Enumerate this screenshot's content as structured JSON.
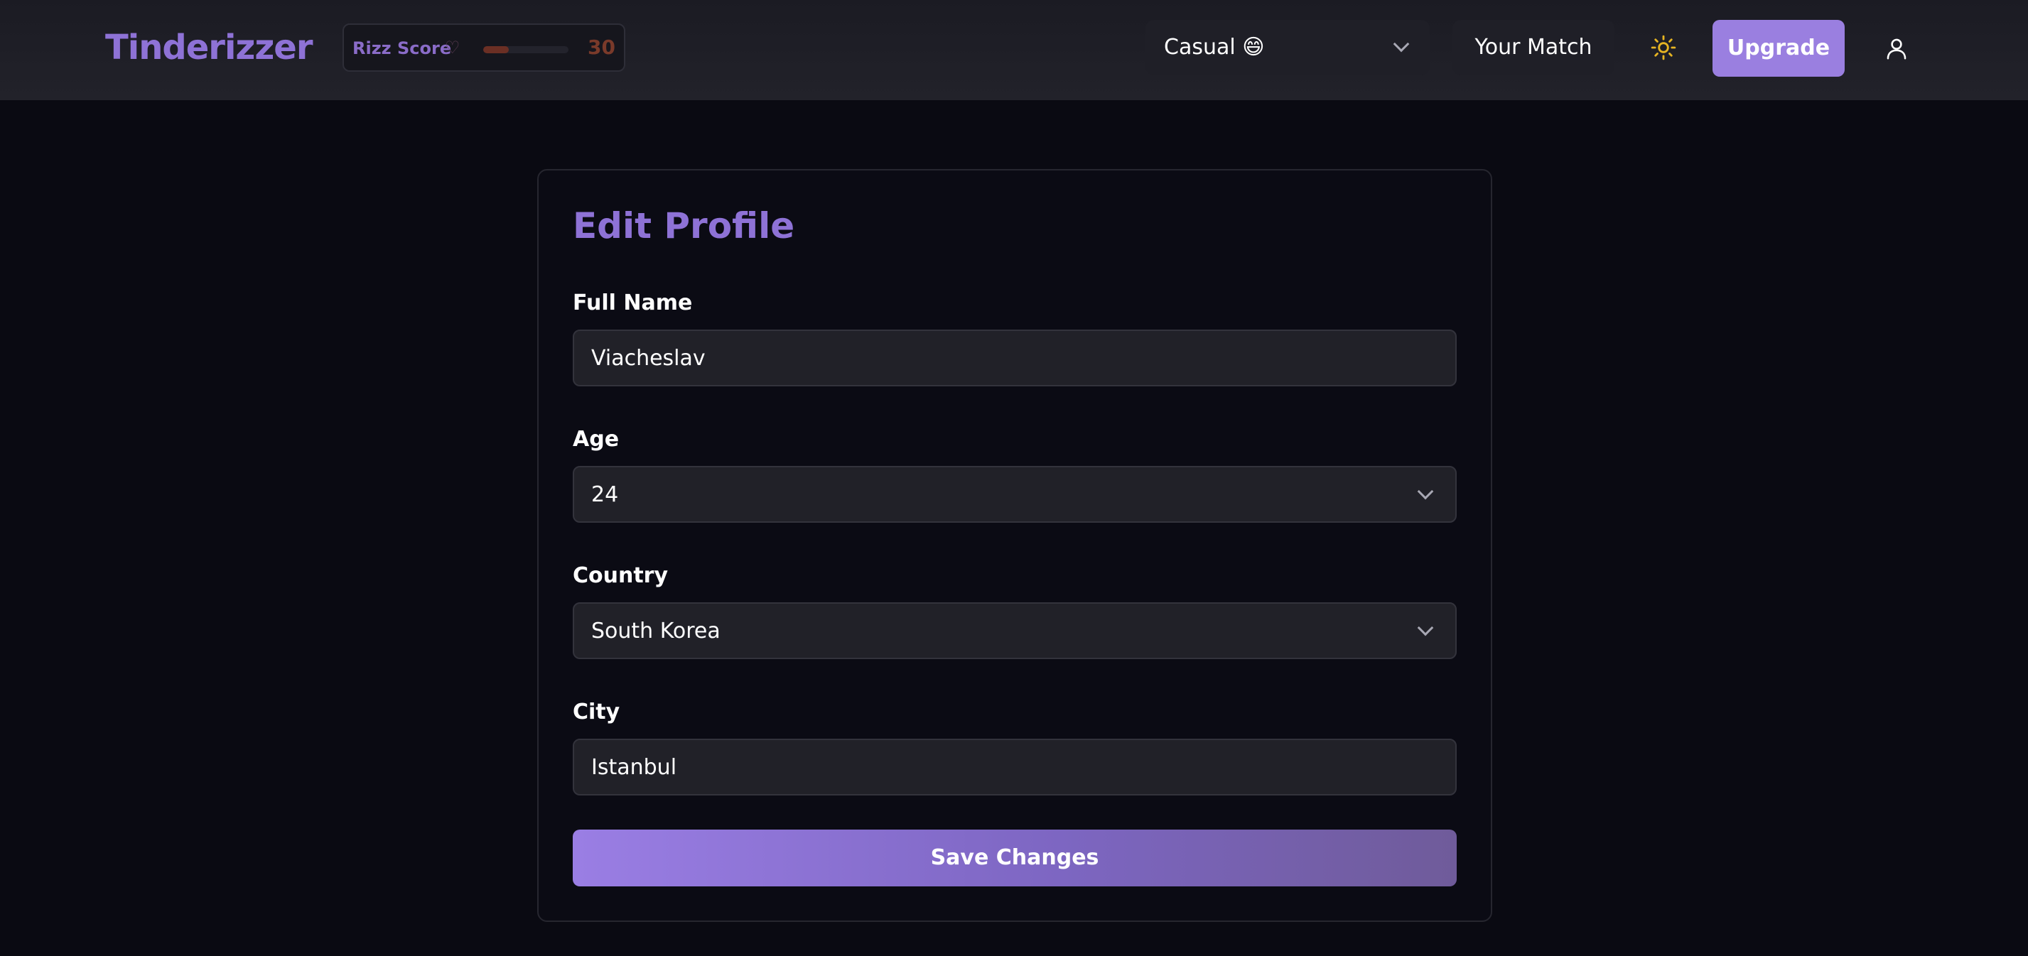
{
  "app": {
    "name": "Tinderizzer"
  },
  "rizz": {
    "label": "Rizz Score",
    "value": "30",
    "level": 0.3
  },
  "header": {
    "mode": "Casual 😄",
    "your_match": "Your Match",
    "upgrade": "Upgrade"
  },
  "profile": {
    "title": "Edit Profile",
    "full_name_label": "Full Name",
    "full_name_value": "Viacheslav",
    "age_label": "Age",
    "age_value": "24",
    "country_label": "Country",
    "country_value": "South Korea",
    "city_label": "City",
    "city_value": "Istanbul",
    "save_label": "Save Changes"
  },
  "colors": {
    "accent": "#8e72d6",
    "upgrade_bg": "#9a7fe0",
    "sun": "#e6b422",
    "background": "#0a0a12"
  },
  "icons": {
    "heart": "heart-icon",
    "sun": "sun-icon",
    "user": "user-icon",
    "chevron": "chevron-down-icon"
  }
}
